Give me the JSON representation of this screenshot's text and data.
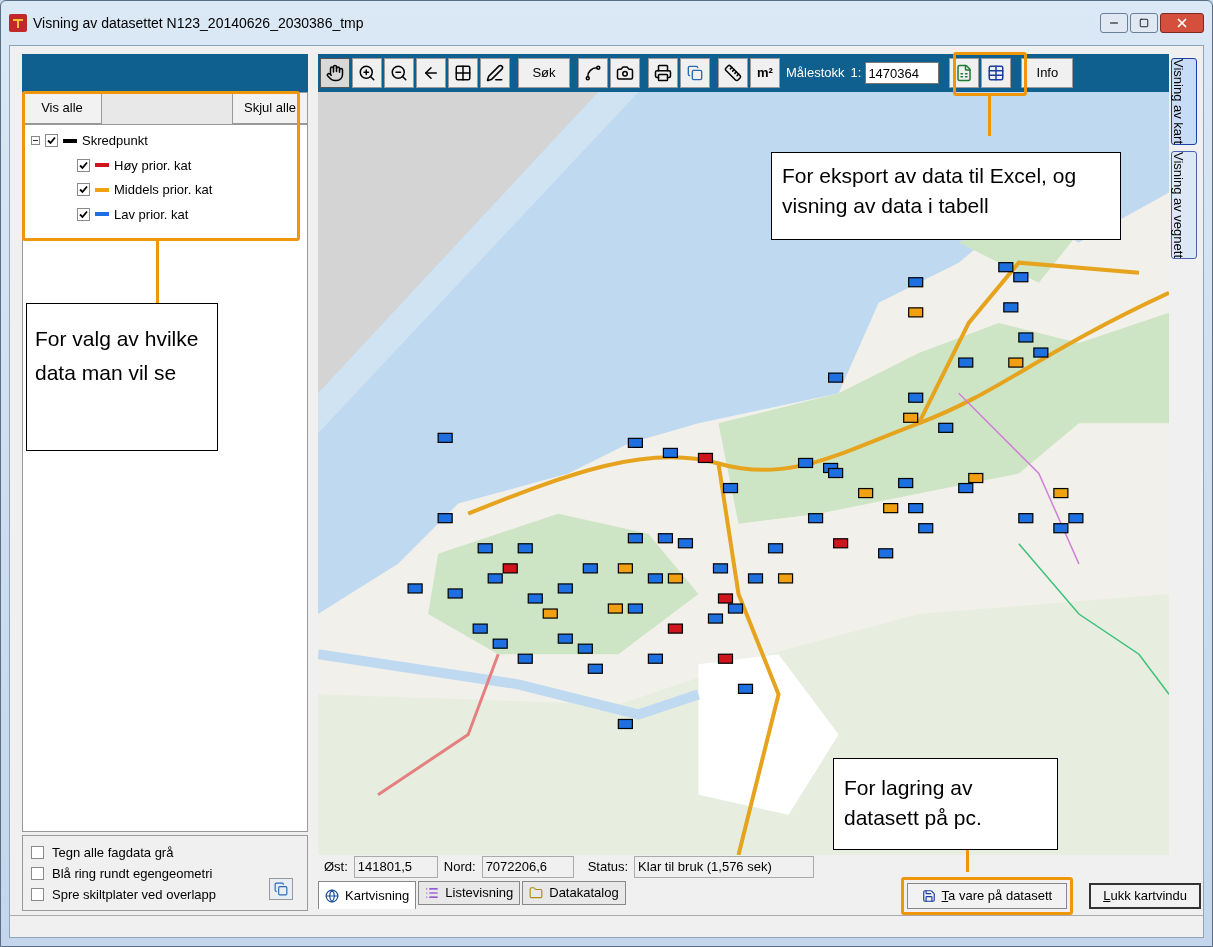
{
  "window": {
    "title": "Visning av datasettet N123_20140626_2030386_tmp"
  },
  "legend": {
    "show_all": "Vis alle",
    "hide_all": "Skjul alle",
    "tree": {
      "label": "Skredpunkt",
      "checked": true,
      "expanded": true,
      "color": "#000000",
      "children": [
        {
          "label": "Høy prior. kat",
          "checked": true,
          "color": "#d0141c"
        },
        {
          "label": "Middels prior. kat",
          "checked": true,
          "color": "#f0a010"
        },
        {
          "label": "Lav prior. kat",
          "checked": true,
          "color": "#1e6fe0"
        }
      ]
    }
  },
  "options": [
    {
      "label": "Tegn alle fagdata grå",
      "checked": false
    },
    {
      "label": "Blå ring rundt egengeometri",
      "checked": false
    },
    {
      "label": "Spre skiltplater ved overlapp",
      "checked": false
    }
  ],
  "toolbar": {
    "tools": [
      {
        "selected": true
      },
      {
        "selected": false
      },
      {
        "selected": false
      },
      {
        "selected": false
      },
      {
        "selected": false
      },
      {
        "selected": false
      }
    ],
    "search_button": "Søk",
    "area_button": "m²",
    "scale_label": "Målestokk",
    "scale_prefix": "1:",
    "scale_value": "1470364",
    "info_button": "Info"
  },
  "side_tabs": [
    {
      "label": "Visning av kart",
      "selected": true
    },
    {
      "label": "Visning av vegnett",
      "selected": false
    }
  ],
  "status": {
    "east_label": "Øst:",
    "east_value": "141801,5",
    "north_label": "Nord:",
    "north_value": "7072206,6",
    "status_label": "Status:",
    "status_value": "Klar til bruk (1,576 sek)"
  },
  "bottom_tabs": [
    {
      "label": "Kartvisning",
      "selected": true
    },
    {
      "label": "Listevisning",
      "selected": false
    },
    {
      "label": "Datakatalog",
      "selected": false
    }
  ],
  "save_button": "Ta vare på datasett",
  "close_button": "Lukk kartvindu",
  "callouts": [
    {
      "text": "For valg av hvilke data man vil se"
    },
    {
      "text": "For eksport av data til Excel, og visning av data i tabell"
    },
    {
      "text": "For lagring av datasett på pc."
    }
  ]
}
